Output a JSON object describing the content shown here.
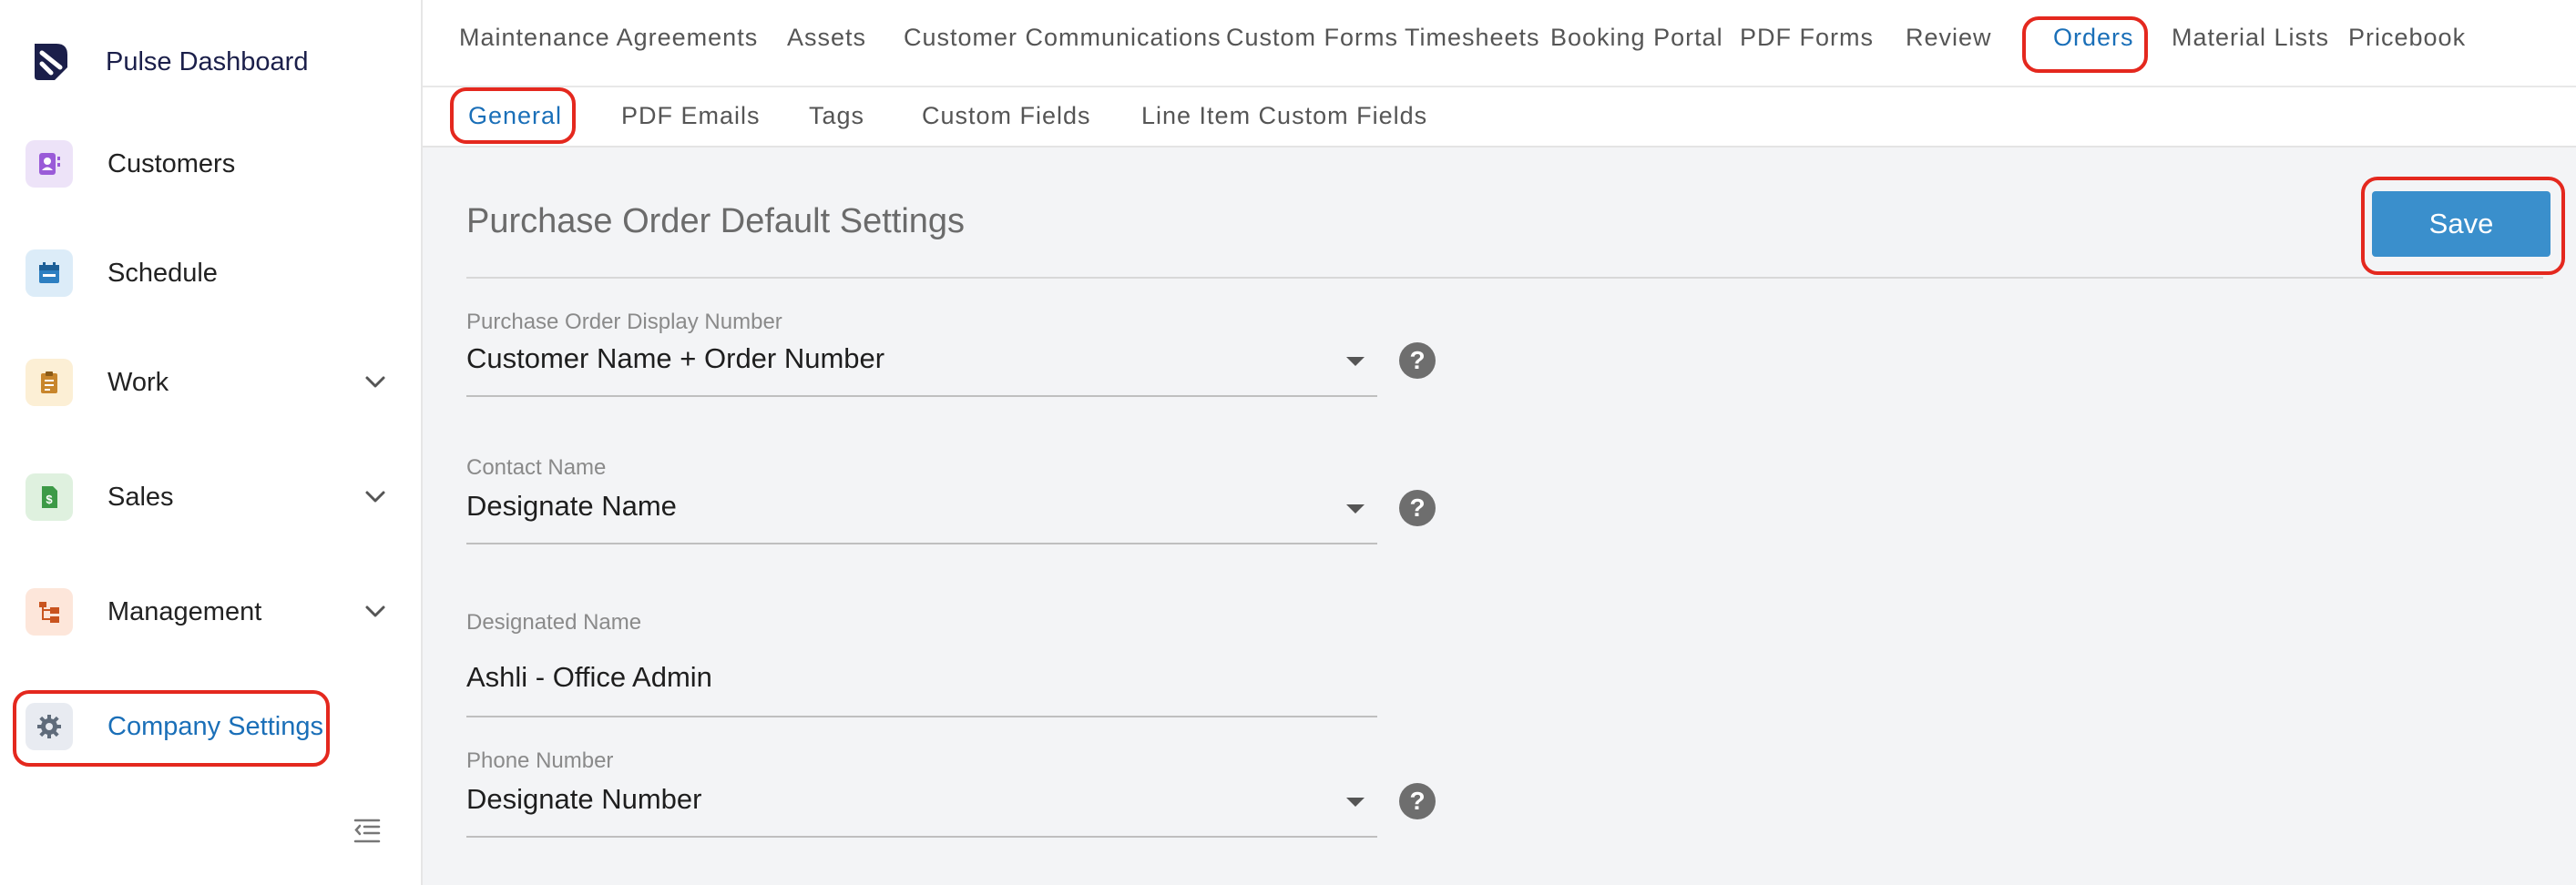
{
  "sidebar": {
    "brand": "Pulse Dashboard",
    "items": [
      {
        "label": "Customers",
        "icon": "customers-icon"
      },
      {
        "label": "Schedule",
        "icon": "calendar-icon"
      },
      {
        "label": "Work",
        "icon": "clipboard-icon"
      },
      {
        "label": "Sales",
        "icon": "invoice-icon"
      },
      {
        "label": "Management",
        "icon": "org-chart-icon"
      },
      {
        "label": "Company Settings",
        "icon": "gear-icon"
      }
    ]
  },
  "top_tabs": [
    "Maintenance Agreements",
    "Assets",
    "Customer Communications",
    "Custom Forms",
    "Timesheets",
    "Booking Portal",
    "PDF Forms",
    "Review",
    "Orders",
    "Material Lists",
    "Pricebook"
  ],
  "sub_tabs": [
    "General",
    "PDF Emails",
    "Tags",
    "Custom Fields",
    "Line Item Custom Fields"
  ],
  "main": {
    "title": "Purchase Order Default Settings",
    "save_label": "Save",
    "help_glyph": "?",
    "fields": [
      {
        "label": "Purchase Order Display Number",
        "value": "Customer Name + Order Number"
      },
      {
        "label": "Contact Name",
        "value": "Designate Name"
      },
      {
        "label": "Designated Name",
        "value": "Ashli - Office Admin"
      },
      {
        "label": "Phone Number",
        "value": "Designate Number"
      }
    ]
  },
  "colors": {
    "accent": "#1a6fb8",
    "save_button": "#3a8fcc",
    "annotation": "#e4281e"
  }
}
